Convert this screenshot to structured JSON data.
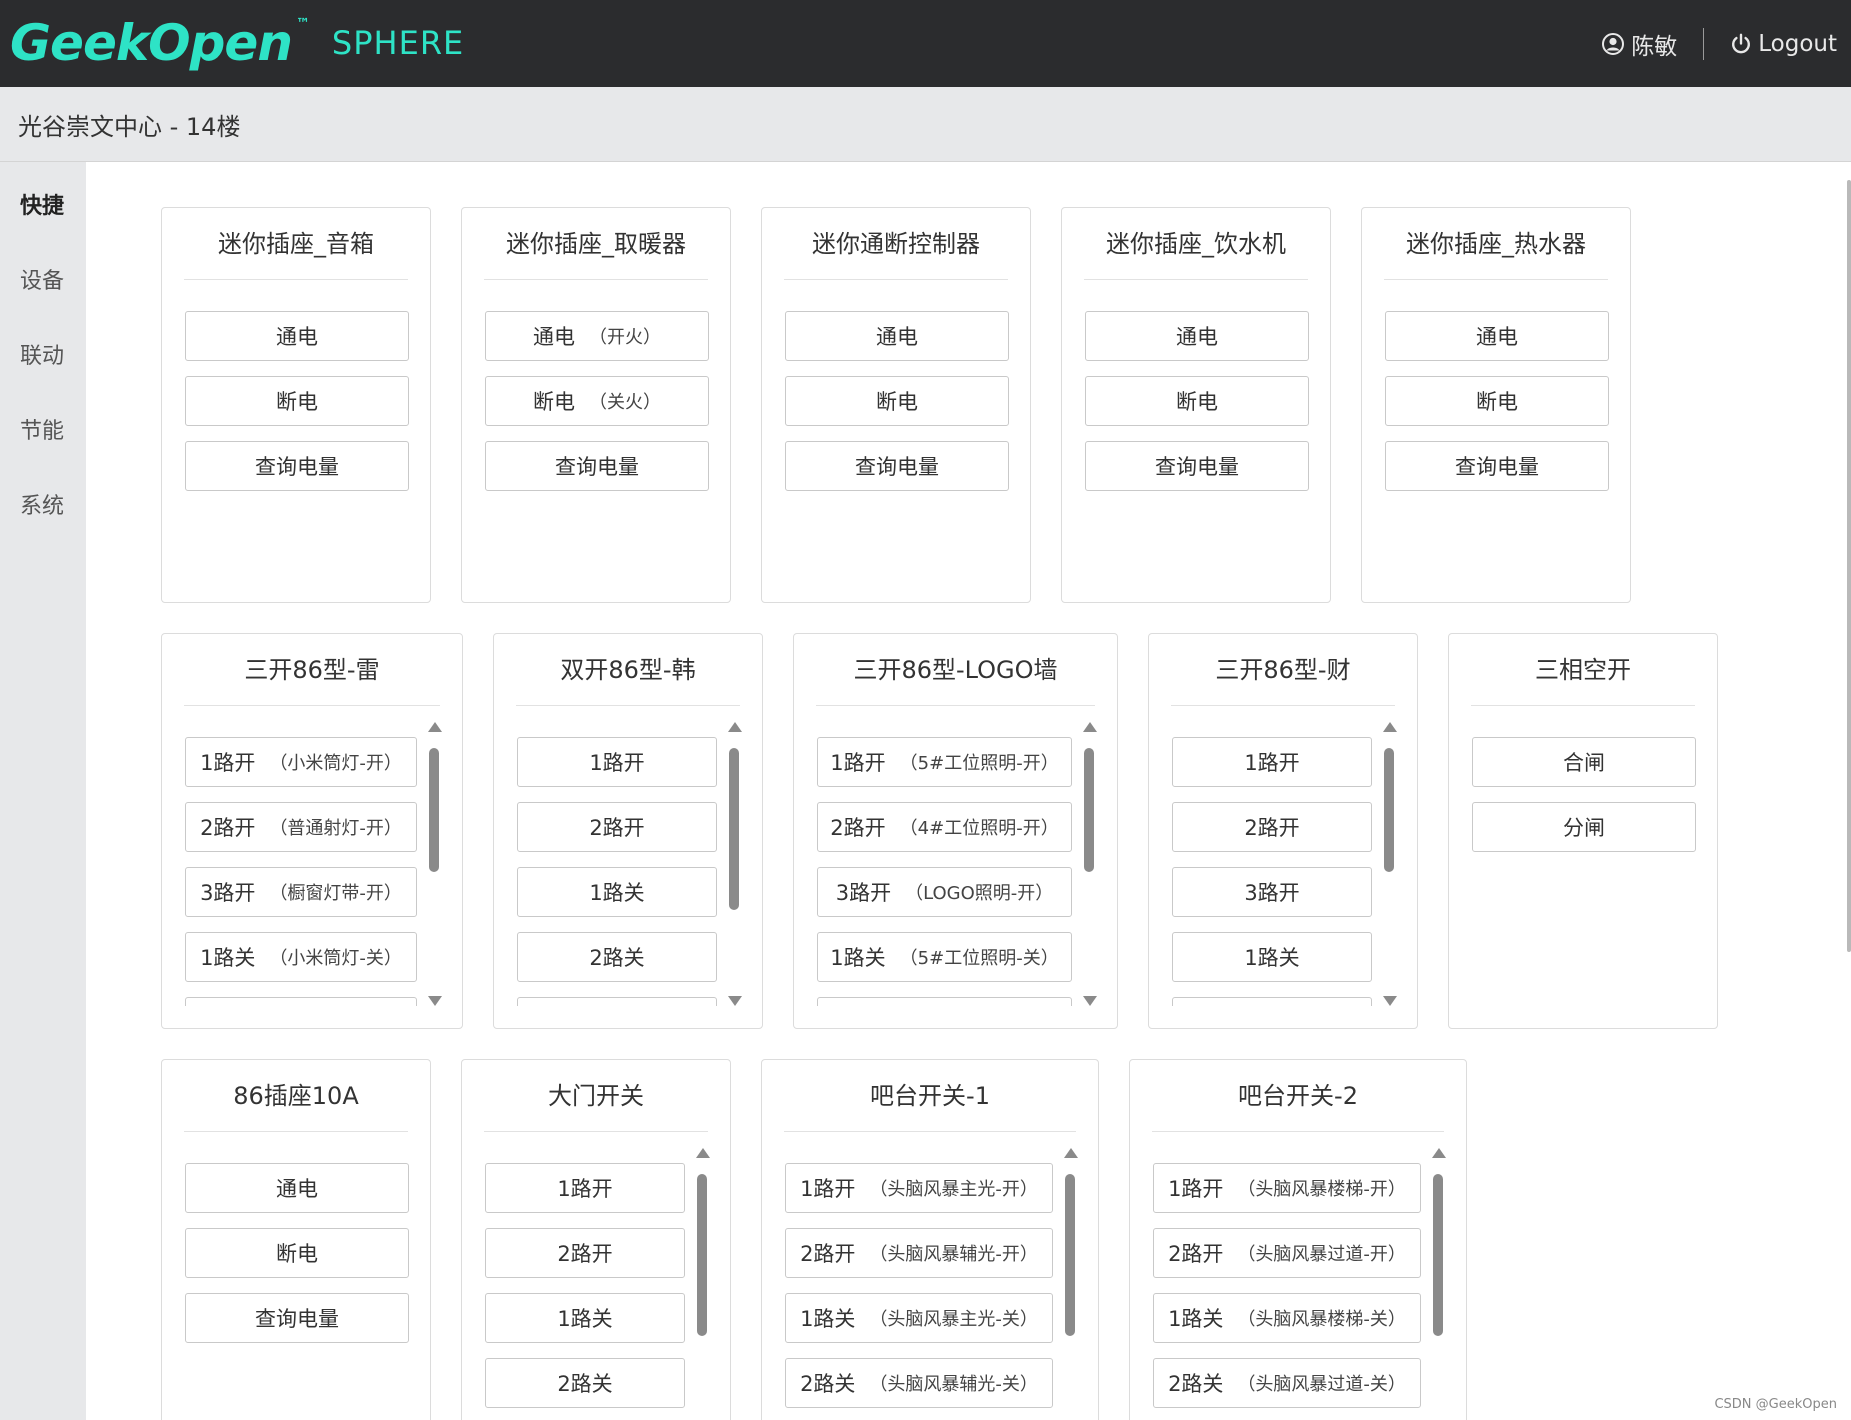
{
  "header": {
    "logo_text": "GeekOpen",
    "logo_tm": "™",
    "logo_sphere": "SPHERE",
    "user_name": "陈敏",
    "logout_label": "Logout",
    "accent_color": "#2ee3c6",
    "user_icon": "user-circle-icon",
    "logout_icon": "power-icon"
  },
  "location": {
    "title": "光谷崇文中心 - 14楼"
  },
  "sidebar": {
    "items": [
      {
        "label": "快捷",
        "active": true
      },
      {
        "label": "设备"
      },
      {
        "label": "联动"
      },
      {
        "label": "节能"
      },
      {
        "label": "系统"
      }
    ]
  },
  "cards": {
    "c0": {
      "title": "迷你插座_音箱",
      "buttons": [
        {
          "label": "通电"
        },
        {
          "label": "断电"
        },
        {
          "label": "查询电量"
        }
      ]
    },
    "c1": {
      "title": "迷你插座_取暖器",
      "buttons": [
        {
          "label": "通电",
          "sub": "（开火）"
        },
        {
          "label": "断电",
          "sub": "（关火）"
        },
        {
          "label": "查询电量"
        }
      ]
    },
    "c2": {
      "title": "迷你通断控制器",
      "buttons": [
        {
          "label": "通电"
        },
        {
          "label": "断电"
        },
        {
          "label": "查询电量"
        }
      ]
    },
    "c3": {
      "title": "迷你插座_饮水机",
      "buttons": [
        {
          "label": "通电"
        },
        {
          "label": "断电"
        },
        {
          "label": "查询电量"
        }
      ]
    },
    "c4": {
      "title": "迷你插座_热水器",
      "buttons": [
        {
          "label": "通电"
        },
        {
          "label": "断电"
        },
        {
          "label": "查询电量"
        }
      ]
    },
    "c5": {
      "title": "三开86型-雷",
      "buttons": [
        {
          "label": "1路开",
          "sub": "（小米筒灯-开）"
        },
        {
          "label": "2路开",
          "sub": "（普通射灯-开）"
        },
        {
          "label": "3路开",
          "sub": "（橱窗灯带-开）"
        },
        {
          "label": "1路关",
          "sub": "（小米筒灯-关）"
        }
      ]
    },
    "c6": {
      "title": "双开86型-韩",
      "buttons": [
        {
          "label": "1路开"
        },
        {
          "label": "2路开"
        },
        {
          "label": "1路关"
        },
        {
          "label": "2路关"
        }
      ]
    },
    "c7": {
      "title": "三开86型-LOGO墙",
      "buttons": [
        {
          "label": "1路开",
          "sub": "（5#工位照明-开）"
        },
        {
          "label": "2路开",
          "sub": "（4#工位照明-开）"
        },
        {
          "label": "3路开",
          "sub": "（LOGO照明-开）"
        },
        {
          "label": "1路关",
          "sub": "（5#工位照明-关）"
        }
      ]
    },
    "c8": {
      "title": "三开86型-财",
      "buttons": [
        {
          "label": "1路开"
        },
        {
          "label": "2路开"
        },
        {
          "label": "3路开"
        },
        {
          "label": "1路关"
        }
      ]
    },
    "c9": {
      "title": "三相空开",
      "buttons": [
        {
          "label": "合闸"
        },
        {
          "label": "分闸"
        }
      ]
    },
    "c10": {
      "title": "86插座10A",
      "buttons": [
        {
          "label": "通电"
        },
        {
          "label": "断电"
        },
        {
          "label": "查询电量"
        }
      ]
    },
    "c11": {
      "title": "大门开关",
      "buttons": [
        {
          "label": "1路开"
        },
        {
          "label": "2路开"
        },
        {
          "label": "1路关"
        },
        {
          "label": "2路关"
        }
      ]
    },
    "c12": {
      "title": "吧台开关-1",
      "buttons": [
        {
          "label": "1路开",
          "sub": "（头脑风暴主光-开）"
        },
        {
          "label": "2路开",
          "sub": "（头脑风暴辅光-开）"
        },
        {
          "label": "1路关",
          "sub": "（头脑风暴主光-关）"
        },
        {
          "label": "2路关",
          "sub": "（头脑风暴辅光-关）"
        }
      ]
    },
    "c13": {
      "title": "吧台开关-2",
      "buttons": [
        {
          "label": "1路开",
          "sub": "（头脑风暴楼梯-开）"
        },
        {
          "label": "2路开",
          "sub": "（头脑风暴过道-开）"
        },
        {
          "label": "1路关",
          "sub": "（头脑风暴楼梯-关）"
        },
        {
          "label": "2路关",
          "sub": "（头脑风暴过道-关）"
        }
      ]
    }
  },
  "watermark": "CSDN @GeekOpen"
}
